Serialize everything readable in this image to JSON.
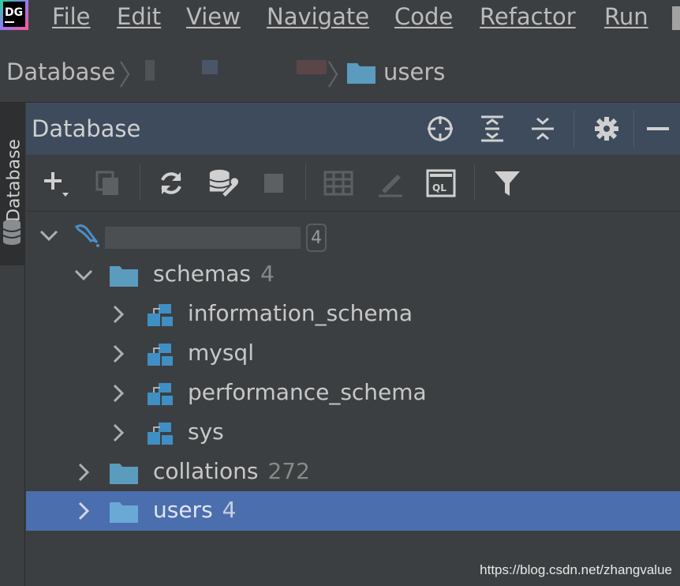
{
  "app": {
    "logo_text": "DG"
  },
  "menu": {
    "items": [
      {
        "label": "File"
      },
      {
        "label": "Edit"
      },
      {
        "label": "View"
      },
      {
        "label": "Navigate"
      },
      {
        "label": "Code"
      },
      {
        "label": "Refactor"
      },
      {
        "label": "Run"
      }
    ]
  },
  "breadcrumb": {
    "root": "Database",
    "current": "users"
  },
  "side_stripe": {
    "label": "Database"
  },
  "tool_window": {
    "title": "Database",
    "header_icons": [
      "locate-icon",
      "expand-all-icon",
      "collapse-all-icon",
      "settings-icon",
      "minimize-icon"
    ],
    "toolbar_icons": [
      "add-icon",
      "copy-icon",
      "refresh-icon",
      "data-source-properties-icon",
      "stop-icon",
      "table-view-icon",
      "edit-icon",
      "query-console-icon",
      "filter-icon"
    ]
  },
  "tree": {
    "connection": {
      "badge": "4"
    },
    "schemas": {
      "label": "schemas",
      "count": "4"
    },
    "schema_items": [
      {
        "label": "information_schema"
      },
      {
        "label": "mysql"
      },
      {
        "label": "performance_schema"
      },
      {
        "label": "sys"
      }
    ],
    "collations": {
      "label": "collations",
      "count": "272"
    },
    "users": {
      "label": "users",
      "count": "4"
    }
  },
  "watermark": "https://blog.csdn.net/zhangvalue",
  "colors": {
    "background": "#3c3f41",
    "header": "#3d4b5c",
    "selection": "#4b6eaf",
    "folder": "#5b9bbe",
    "schema_icon": "#3f8fc4"
  }
}
